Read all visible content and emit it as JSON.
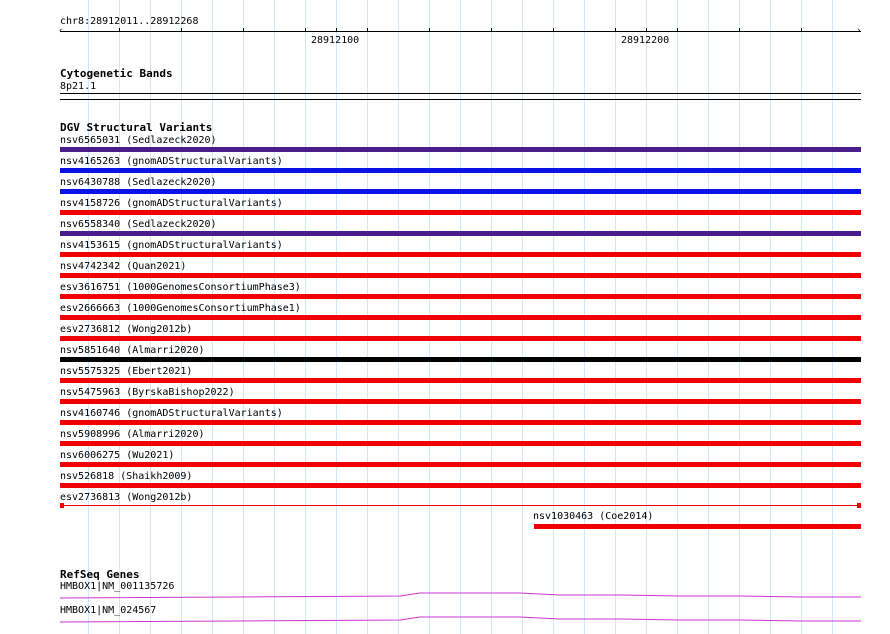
{
  "ruler": {
    "region": "chr8:28912011..28912268",
    "labels": [
      {
        "text": "28912100",
        "pos": 28912100
      },
      {
        "text": "28912200",
        "pos": 28912200
      }
    ]
  },
  "cytobands": {
    "title": "Cytogenetic Bands",
    "band": "8p21.1"
  },
  "dgv": {
    "title": "DGV Structural Variants",
    "variants": [
      {
        "label": "nsv6565031 (Sedlazeck2020)",
        "color": "#4b1c8c"
      },
      {
        "label": "nsv4165263 (gnomADStructuralVariants)",
        "color": "#0a14e6"
      },
      {
        "label": "nsv6430788 (Sedlazeck2020)",
        "color": "#0a14e6"
      },
      {
        "label": "nsv4158726 (gnomADStructuralVariants)",
        "color": "#f00000"
      },
      {
        "label": "nsv6558340 (Sedlazeck2020)",
        "color": "#4b1c8c"
      },
      {
        "label": "nsv4153615 (gnomADStructuralVariants)",
        "color": "#f00000"
      },
      {
        "label": "nsv4742342 (Quan2021)",
        "color": "#f00000"
      },
      {
        "label": "esv3616751 (1000GenomesConsortiumPhase3)",
        "color": "#f00000"
      },
      {
        "label": "esv2666663 (1000GenomesConsortiumPhase1)",
        "color": "#f00000"
      },
      {
        "label": "esv2736812 (Wong2012b)",
        "color": "#f00000"
      },
      {
        "label": "nsv5851640 (Almarri2020)",
        "color": "#000000"
      },
      {
        "label": "nsv5575325 (Ebert2021)",
        "color": "#f00000"
      },
      {
        "label": "nsv5475963 (ByrskaBishop2022)",
        "color": "#f00000"
      },
      {
        "label": "nsv4160746 (gnomADStructuralVariants)",
        "color": "#f00000"
      },
      {
        "label": "nsv5908996 (Almarri2020)",
        "color": "#f00000"
      },
      {
        "label": "nsv6006275 (Wu2021)",
        "color": "#f00000"
      },
      {
        "label": "nsv526818 (Shaikh2009)",
        "color": "#f00000"
      },
      {
        "label": "esv2736813 (Wong2012b)",
        "color": "#f00000",
        "style": "thin"
      },
      {
        "label": "nsv1030463 (Coe2014)",
        "color": "#f00000",
        "partial": true
      }
    ]
  },
  "refseq": {
    "title": "RefSeq Genes",
    "genes": [
      {
        "label": "HMBOX1|NM_001135726",
        "color": "#cc33cc"
      },
      {
        "label": "HMBOX1|NM_024567",
        "color": "#cc33cc"
      }
    ]
  }
}
